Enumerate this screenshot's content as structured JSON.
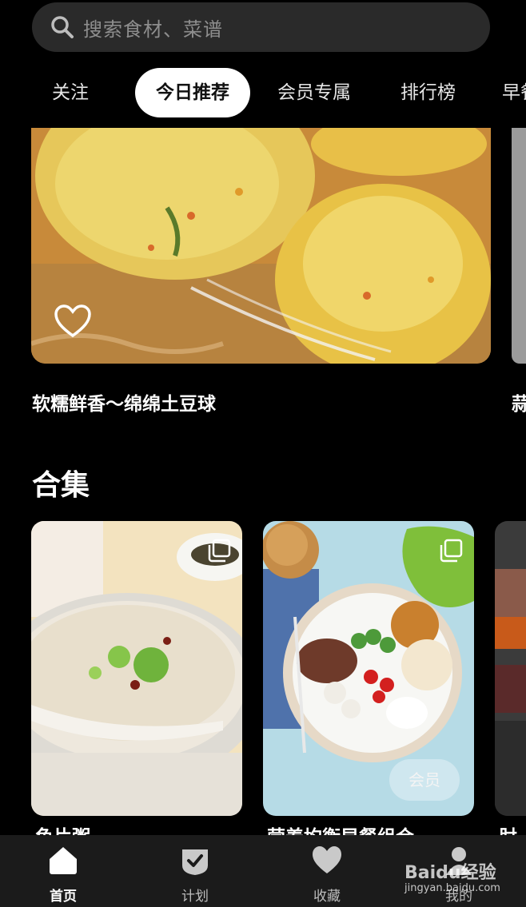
{
  "search": {
    "placeholder": "搜索食材、菜谱"
  },
  "tabs": [
    {
      "label": "关注"
    },
    {
      "label": "今日推荐"
    },
    {
      "label": "会员专属"
    },
    {
      "label": "排行榜"
    },
    {
      "label": "早餐"
    }
  ],
  "hero": {
    "title": "软糯鲜香～绵绵土豆球",
    "side_title": "蒜"
  },
  "collection": {
    "title": "合集",
    "cards": [
      {
        "title": "鱼片粥",
        "icon": "stack-icon"
      },
      {
        "title": "营养均衡早餐组合",
        "badge": "会员",
        "icon": "stack-icon"
      },
      {
        "title": "肘"
      }
    ]
  },
  "tabbar": [
    {
      "label": "首页",
      "icon": "home-icon"
    },
    {
      "label": "计划",
      "icon": "plan-check-icon"
    },
    {
      "label": "收藏",
      "icon": "heart-icon"
    },
    {
      "label": "我的",
      "icon": "profile-icon"
    }
  ],
  "watermark": {
    "logo_text": "Baidu经验",
    "url": "jingyan.baidu.com"
  }
}
